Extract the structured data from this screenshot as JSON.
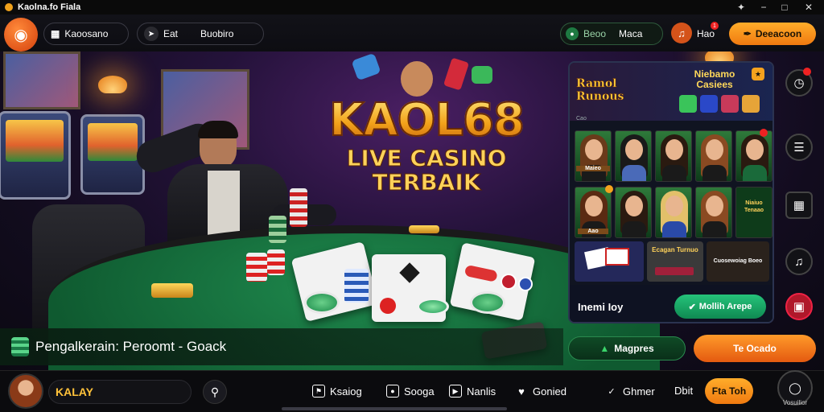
{
  "window": {
    "title": "Kaolna.fo Fiala",
    "controls": [
      "−",
      "□",
      "✕"
    ]
  },
  "topnav": {
    "brand_label": "Kaoosano",
    "chat_label": "Eat",
    "browse_label": "Buobiro",
    "wallet_label": "Beoo",
    "wallet_value": "Maca",
    "notif_label": "Hao",
    "notif_badge": "1",
    "deposit_label": "Deeacoon"
  },
  "hero": {
    "title": "KAOL68",
    "line1": "LIVE CASINO",
    "line2": "TERBAIK"
  },
  "panel": {
    "logo_text": "Ramol Runous",
    "header_title": "Niebamo Casiees",
    "small_tag": "Cao",
    "thumb_captions": [
      "Maieo",
      "Aao",
      "Niaiuo Tenaao"
    ],
    "tiles": [
      "Ecagan Turnuo",
      "Cuosewoiag Boeo"
    ],
    "footer_label": "Inemi Ioy",
    "footer_button": "Mollih Arepe"
  },
  "promo": {
    "text": "Pengalkerain: Peroomt - Goack",
    "btn_secondary": "Magpres",
    "btn_primary": "Te Ocado"
  },
  "bottombar": {
    "user_name": "KALAY",
    "nav": [
      "Ksaiog",
      "Sooga",
      "Nanlis",
      "Gonied",
      "Ghmer"
    ],
    "extra_label": "Dbit",
    "cta_label": "Fta Toh",
    "profile_label": "Vosuilior"
  },
  "colors": {
    "accent_orange": "#f5901e",
    "accent_green": "#1fb86a",
    "bg_dark": "#0c0c10"
  }
}
